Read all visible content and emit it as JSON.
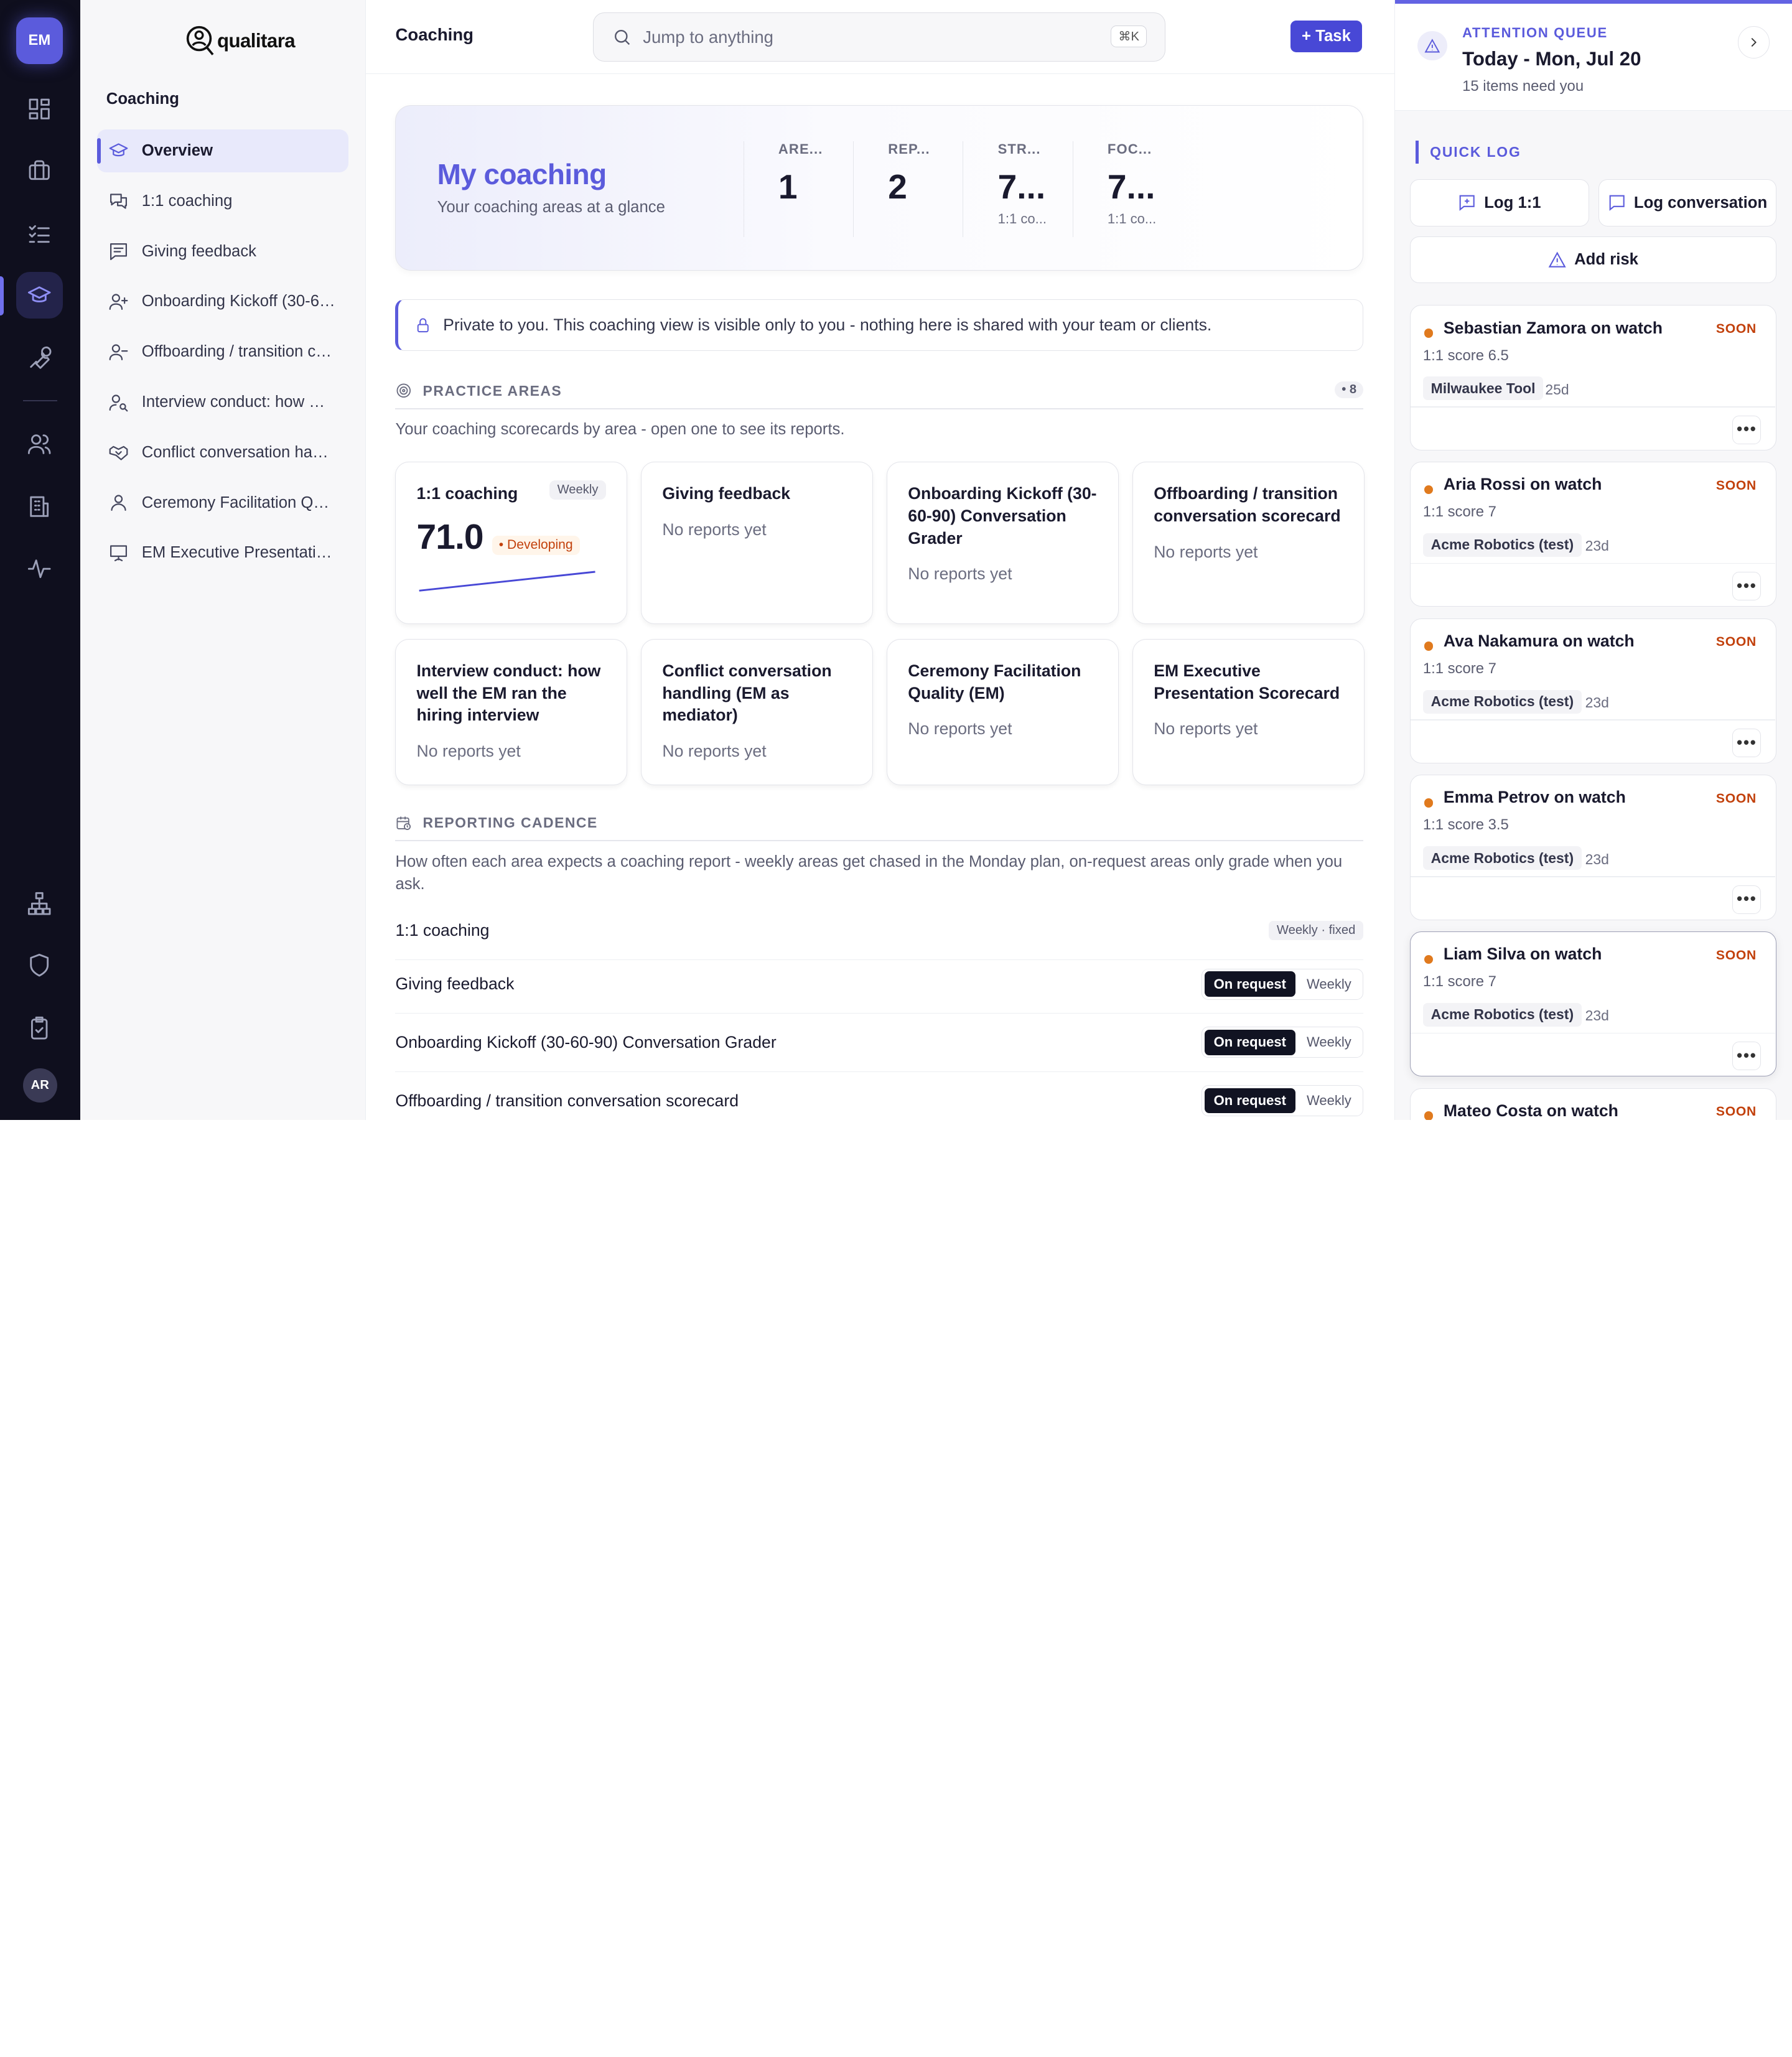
{
  "rail": {
    "avatar": "EM",
    "user_initials": "AR",
    "icons": [
      "dashboard-icon",
      "briefcase-icon",
      "checklist-icon",
      "graduation-cap-icon",
      "wrench-icon",
      "people-icon",
      "building-icon",
      "activity-icon",
      "org-chart-icon",
      "shield-icon",
      "clipboard-check-icon"
    ],
    "active": "graduation-cap-icon"
  },
  "brand": {
    "name": "qualitara"
  },
  "sidenav": {
    "section": "Coaching",
    "items": [
      {
        "label": "Overview",
        "icon": "graduation-cap-icon"
      },
      {
        "label": "1:1 coaching",
        "icon": "chat-bubbles-icon"
      },
      {
        "label": "Giving feedback",
        "icon": "message-square-icon"
      },
      {
        "label": "Onboarding Kickoff (30-60-90) Conversation Grader",
        "icon": "user-plus-icon"
      },
      {
        "label": "Offboarding / transition conversation scorecard",
        "icon": "user-minus-icon"
      },
      {
        "label": "Interview conduct: how well the EM ran the hiring interview",
        "icon": "user-search-icon"
      },
      {
        "label": "Conflict conversation handling (EM as mediator)",
        "icon": "handshake-icon"
      },
      {
        "label": "Ceremony Facilitation Quality (EM)",
        "icon": "users-icon"
      },
      {
        "label": "EM Executive Presentation Scorecard",
        "icon": "presentation-icon"
      }
    ]
  },
  "header": {
    "title": "Coaching",
    "search_placeholder": "Jump to anything",
    "shortcut": "⌘K",
    "task_button": "+ Task"
  },
  "hero": {
    "title": "My coaching",
    "subtitle": "Your coaching areas at a glance",
    "stats": [
      {
        "label": "ARE...",
        "value": "1",
        "sub": ""
      },
      {
        "label": "REP...",
        "value": "2",
        "sub": ""
      },
      {
        "label": "STR...",
        "value": "7...",
        "sub": "1:1 co..."
      },
      {
        "label": "FOC...",
        "value": "7...",
        "sub": "1:1 co..."
      }
    ]
  },
  "privacy_note": "Private to you. This coaching view is visible only to you - nothing here is shared with your team or clients.",
  "practice": {
    "heading": "PRACTICE AREAS",
    "count": "• 8",
    "description": "Your coaching scorecards by area - open one to see its reports.",
    "cards": [
      {
        "title": "1:1 coaching",
        "tag": "Weekly",
        "score": "71.0",
        "level": "• Developing",
        "trend": [
          62,
          65,
          68,
          71
        ]
      },
      {
        "title": "Giving feedback",
        "status": "No reports yet"
      },
      {
        "title": "Onboarding Kickoff (30-60-90) Conversation Grader",
        "status": "No reports yet"
      },
      {
        "title": "Offboarding / transition conversation scorecard",
        "status": "No reports yet"
      },
      {
        "title": "Interview conduct: how well the EM ran the hiring interview",
        "status": "No reports yet"
      },
      {
        "title": "Conflict conversation handling (EM as mediator)",
        "status": "No reports yet"
      },
      {
        "title": "Ceremony Facilitation Quality (EM)",
        "status": "No reports yet"
      },
      {
        "title": "EM Executive Presentation Scorecard",
        "status": "No reports yet"
      }
    ]
  },
  "cadence": {
    "heading": "REPORTING CADENCE",
    "description": "How often each area expects a coaching report - weekly areas get chased in the Monday plan, on-request areas only grade when you ask.",
    "fixed_label": "Weekly · fixed",
    "opt_request": "On request",
    "opt_weekly": "Weekly",
    "rows": [
      {
        "name": "1:1 coaching",
        "mode": "fixed"
      },
      {
        "name": "Giving feedback",
        "mode": "On request"
      },
      {
        "name": "Onboarding Kickoff (30-60-90) Conversation Grader",
        "mode": "On request"
      },
      {
        "name": "Offboarding / transition conversation scorecard",
        "mode": "On request"
      }
    ]
  },
  "attention": {
    "kicker": "ATTENTION QUEUE",
    "date": "Today - Mon, Jul 20",
    "count_text": "15 items need you"
  },
  "quick_log": {
    "heading": "QUICK LOG",
    "log_11": "Log 1:1",
    "log_conv": "Log conversation",
    "add_risk": "Add risk"
  },
  "queue": [
    {
      "name": "Sebastian Zamora on watch",
      "badge": "SOON",
      "score": "1:1 score 6.5",
      "company": "Milwaukee Tool",
      "age": "25d"
    },
    {
      "name": "Aria Rossi on watch",
      "badge": "SOON",
      "score": "1:1 score 7",
      "company": "Acme Robotics (test)",
      "age": "23d"
    },
    {
      "name": "Ava Nakamura on watch",
      "badge": "SOON",
      "score": "1:1 score 7",
      "company": "Acme Robotics (test)",
      "age": "23d"
    },
    {
      "name": "Emma Petrov on watch",
      "badge": "SOON",
      "score": "1:1 score 3.5",
      "company": "Acme Robotics (test)",
      "age": "23d"
    },
    {
      "name": "Liam Silva on watch",
      "badge": "SOON",
      "score": "1:1 score 7",
      "company": "Acme Robotics (test)",
      "age": "23d"
    },
    {
      "name": "Mateo Costa on watch",
      "badge": "SOON",
      "score": "",
      "company": "",
      "age": ""
    }
  ],
  "colors": {
    "accent": "#5b5bdc",
    "warning": "#e07a1e",
    "rail": "#0f0f1e"
  }
}
